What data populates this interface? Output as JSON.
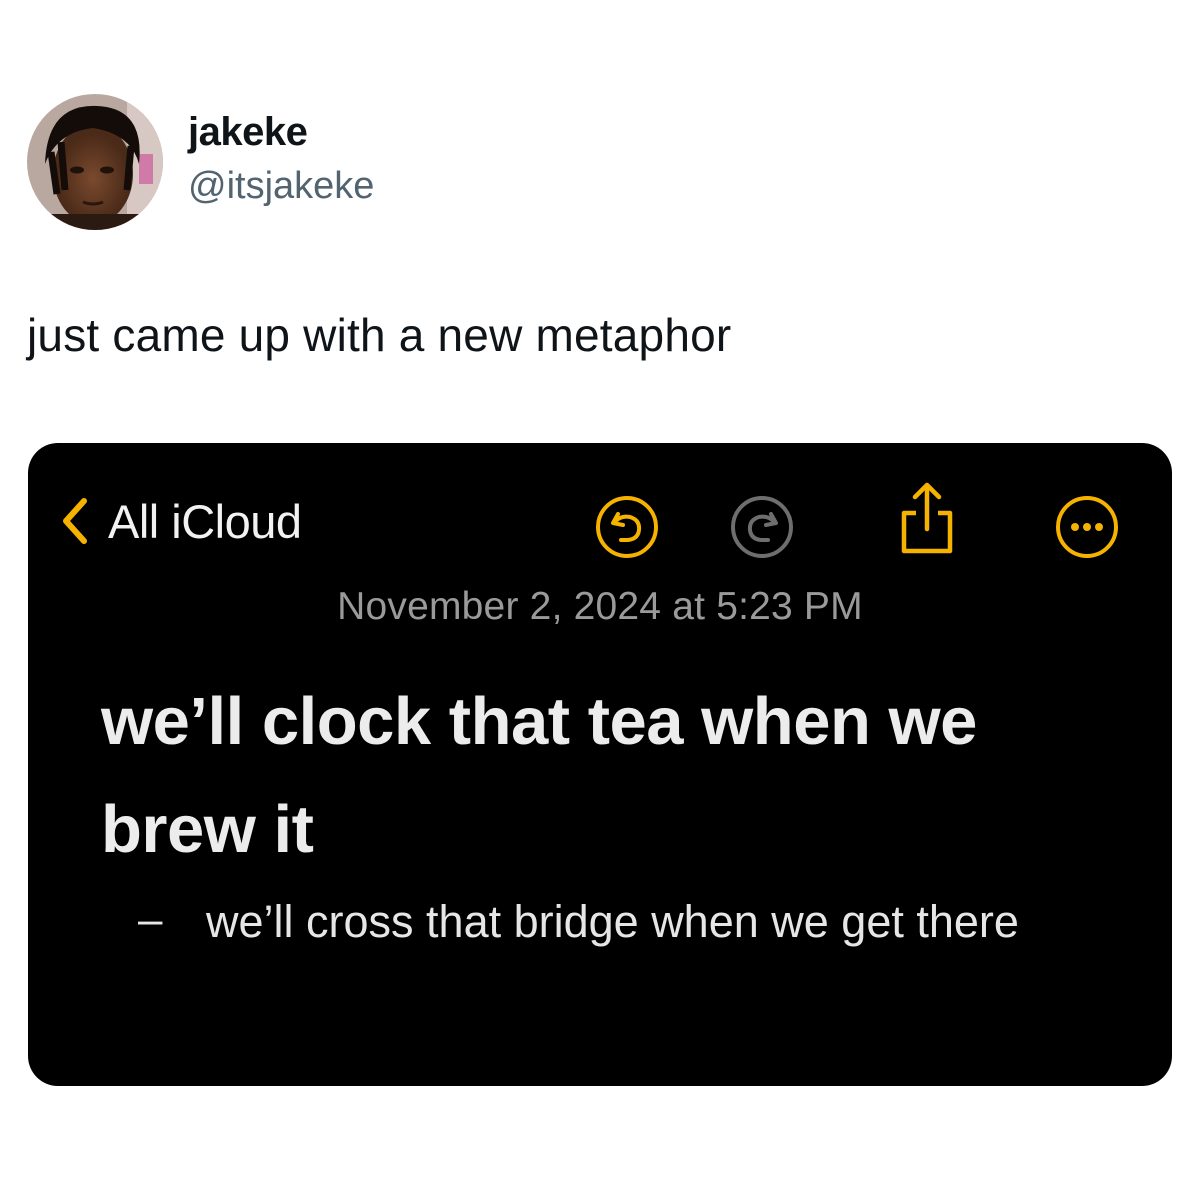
{
  "tweet": {
    "author": {
      "display_name": "jakeke",
      "handle": "@itsjakeke"
    },
    "text": "just came up with a new metaphor"
  },
  "note_screenshot": {
    "toolbar": {
      "back_label": "All iCloud",
      "icons": [
        "chevron-left-icon",
        "undo-icon",
        "redo-icon",
        "share-icon",
        "more-icon"
      ]
    },
    "date": "November 2, 2024 at 5:23 PM",
    "title": "we’ll clock that tea when we brew it",
    "bullet": {
      "marker": "–",
      "text": "we’ll cross that bridge when we get there"
    }
  },
  "colors": {
    "accent": "#f5b300",
    "card_background": "#000000",
    "disabled_icon": "#6e6e6e",
    "handle_text": "#536471"
  }
}
